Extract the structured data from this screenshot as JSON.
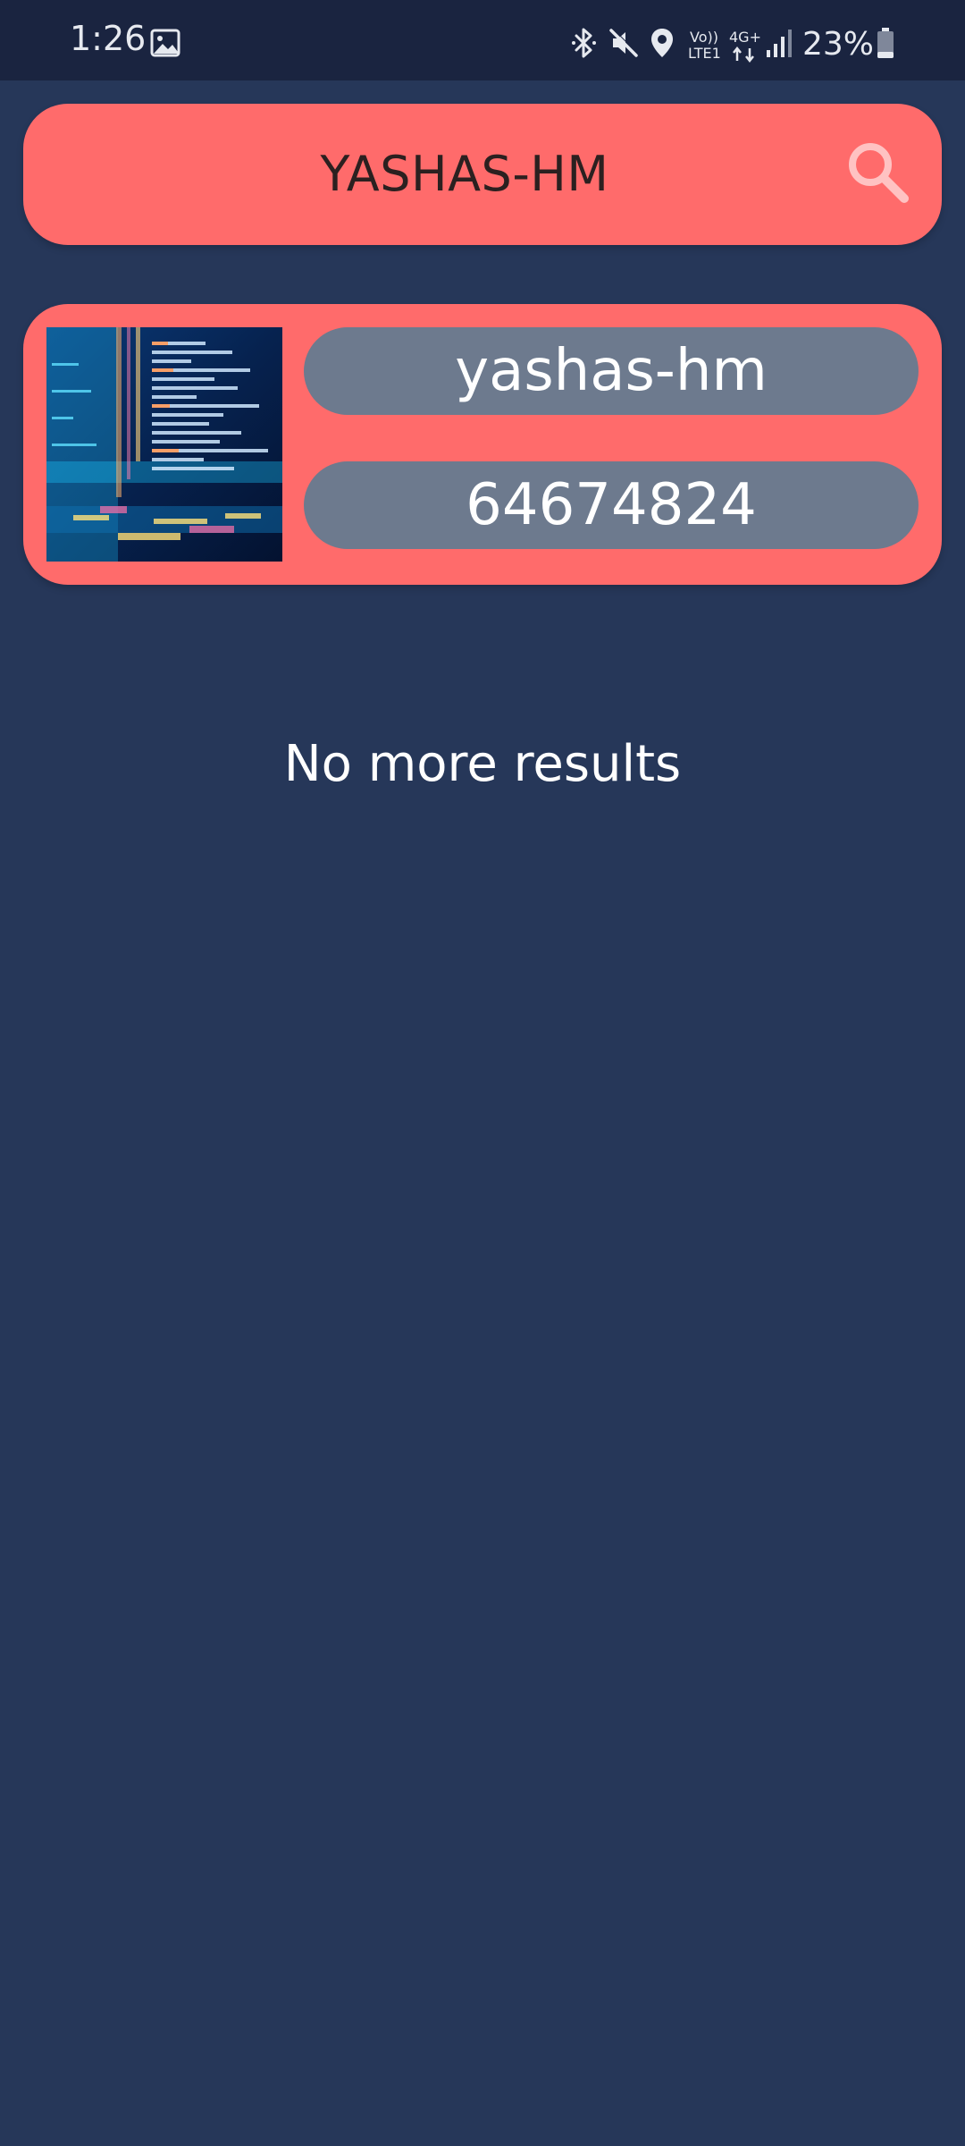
{
  "status_bar": {
    "time": "1:26",
    "network_voice": "Vo))",
    "network_lte": "LTE1",
    "network_type": "4G+",
    "battery_percent": "23%",
    "battery_level": 0.23,
    "icons": [
      "image-notification-icon",
      "bluetooth-icon",
      "mute-icon",
      "location-icon",
      "signal-icon",
      "battery-icon"
    ]
  },
  "search": {
    "value": "YASHAS-HM",
    "icon": "search-icon",
    "colors": {
      "background": "#ff6b6b",
      "icon": "#ffc2c2"
    }
  },
  "results": [
    {
      "name": "yashas-hm",
      "id": "64674824",
      "thumbnail": "code-screen-thumbnail"
    }
  ],
  "footer_message": "No more results",
  "colors": {
    "page_background": "#263759",
    "status_bar_background": "#1a2440",
    "card_background": "#ff6b6b",
    "pill_background": "#6d7a8e"
  }
}
